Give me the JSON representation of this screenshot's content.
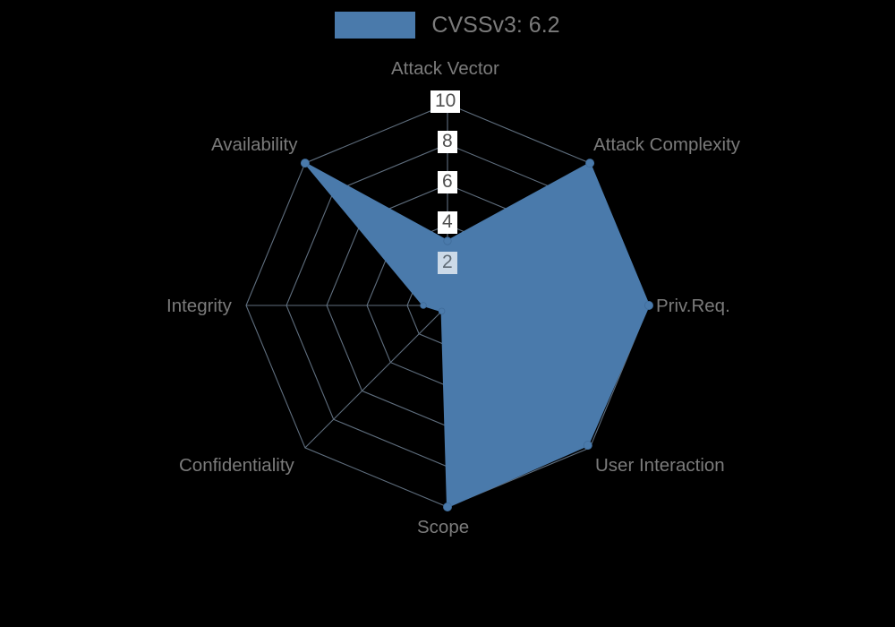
{
  "background_color": "#000000",
  "legend": {
    "swatch_color": "#4a7aab",
    "label": "CVSSv3: 6.2"
  },
  "axis_labels": {
    "attack_vector": "Attack Vector",
    "attack_complexity": "Attack Complexity",
    "priv_req": "Priv.Req.",
    "user_interaction": "User Interaction",
    "scope": "Scope",
    "confidentiality": "Confidentiality",
    "integrity": "Integrity",
    "availability": "Availability"
  },
  "tick_labels": {
    "t10": "10",
    "t8": "8",
    "t6": "6",
    "t4": "4",
    "t2": "2"
  },
  "chart_data": {
    "type": "radar",
    "title": "",
    "series_name": "CVSSv3: 6.2",
    "score": 6.2,
    "categories": [
      "Attack Vector",
      "Attack Complexity",
      "Priv.Req.",
      "User Interaction",
      "Scope",
      "Confidentiality",
      "Integrity",
      "Availability"
    ],
    "values": [
      3.2,
      10.0,
      10.0,
      9.8,
      10.0,
      0.4,
      1.2,
      10.0
    ],
    "rlim": [
      0,
      10
    ],
    "rticks": [
      2,
      4,
      6,
      8,
      10
    ],
    "grid": true,
    "legend_position": "top-center",
    "fill_color": "#4a7aab",
    "fill_opacity": 1.0,
    "marker": "circle",
    "marker_color": "#4a7aab",
    "angle_start_deg": 90,
    "angle_direction": "clockwise"
  }
}
